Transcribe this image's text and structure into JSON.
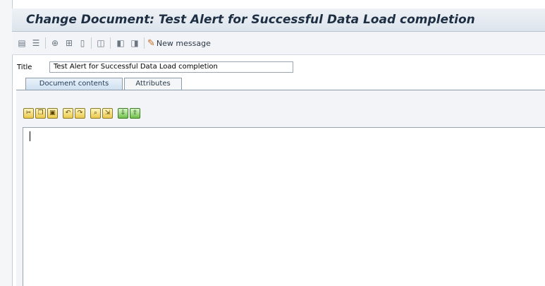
{
  "window": {
    "title": "Change Document: Test Alert for Successful Data Load completion"
  },
  "toolbar": {
    "buttons": [
      {
        "name": "display-icon",
        "glyph": "▤"
      },
      {
        "name": "print-icon",
        "glyph": "☰"
      },
      {
        "name": "change-icon",
        "glyph": "⊕"
      },
      {
        "name": "distribute-icon",
        "glyph": "⊞"
      },
      {
        "name": "delete-icon",
        "glyph": "▯"
      },
      {
        "name": "attach-icon",
        "glyph": "◫"
      },
      {
        "name": "previous-icon",
        "glyph": "◧"
      },
      {
        "name": "next-icon",
        "glyph": "◨"
      }
    ],
    "new_message_label": "New message"
  },
  "form": {
    "title_label": "Title",
    "title_value": "Test Alert for Successful Data Load completion"
  },
  "tabs": [
    {
      "label": "Document contents",
      "active": true
    },
    {
      "label": "Attributes",
      "active": false
    }
  ],
  "editor": {
    "content": ""
  },
  "colors": {
    "title_text": "#1e2f44",
    "accent_tab": "#cfe0f0"
  }
}
